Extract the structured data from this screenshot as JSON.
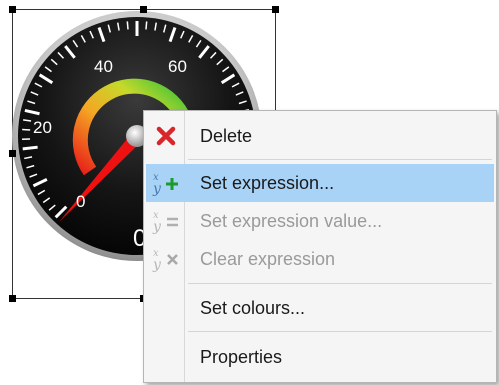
{
  "gauge": {
    "tick_labels": [
      "0",
      "20",
      "40",
      "60"
    ],
    "readout_partial": "0"
  },
  "context_menu": {
    "items": [
      {
        "label": "Delete",
        "icon": "delete-x-icon",
        "enabled": true,
        "highlighted": false
      },
      {
        "label": "Set expression...",
        "icon": "set-expression-icon",
        "enabled": true,
        "highlighted": true
      },
      {
        "label": "Set expression value...",
        "icon": "set-expression-value-icon",
        "enabled": false,
        "highlighted": false
      },
      {
        "label": "Clear expression",
        "icon": "clear-expression-icon",
        "enabled": false,
        "highlighted": false
      },
      {
        "label": "Set colours...",
        "icon": "",
        "enabled": true,
        "highlighted": false
      },
      {
        "label": "Properties",
        "icon": "",
        "enabled": true,
        "highlighted": false
      }
    ]
  },
  "colors": {
    "highlight": "#a8d3f7",
    "delete_red": "#d9262b",
    "add_green": "#1a9b2b",
    "disabled_text": "#9a9a9a",
    "needle_red": "#ee1111"
  }
}
